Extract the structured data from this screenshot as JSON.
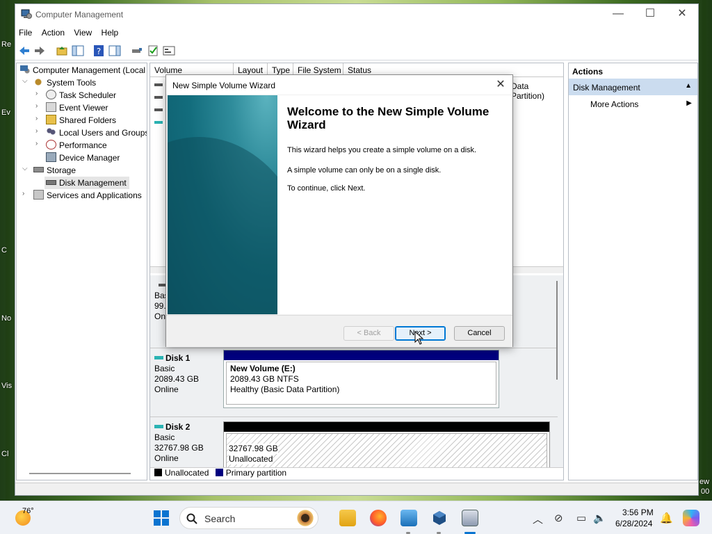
{
  "window": {
    "title": "Computer Management",
    "min": "—",
    "max": "☐",
    "close": "✕"
  },
  "menu": [
    "File",
    "Action",
    "View",
    "Help"
  ],
  "tree": {
    "root": "Computer Management (Local",
    "system_tools": "System Tools",
    "items": [
      "Task Scheduler",
      "Event Viewer",
      "Shared Folders",
      "Local Users and Groups",
      "Performance",
      "Device Manager"
    ],
    "storage": "Storage",
    "disk_management": "Disk Management",
    "services": "Services and Applications"
  },
  "columns": [
    "Volume",
    "Layout",
    "Type",
    "File System",
    "Status"
  ],
  "status_partial": "Data Partition)",
  "disks": {
    "disk0": {
      "l1": "Bas",
      "l2": "99.",
      "l3": "Onl"
    },
    "disk1": {
      "name": "Disk 1",
      "type": "Basic",
      "size": "2089.43 GB",
      "state": "Online",
      "vol_name": "New Volume  (E:)",
      "vol_size": "2089.43 GB NTFS",
      "vol_status": "Healthy (Basic Data Partition)"
    },
    "disk2": {
      "name": "Disk 2",
      "type": "Basic",
      "size": "32767.98 GB",
      "state": "Online",
      "vol_size": "32767.98 GB",
      "vol_status": "Unallocated"
    }
  },
  "legend": {
    "unallocated": "Unallocated",
    "primary": "Primary partition"
  },
  "actions": {
    "header": "Actions",
    "section": "Disk Management",
    "more": "More Actions"
  },
  "wizard": {
    "title": "New Simple Volume Wizard",
    "heading": "Welcome to the New Simple Volume Wizard",
    "p1": "This wizard helps you create a simple volume on a disk.",
    "p2": "A simple volume can only be on a single disk.",
    "p3": "To continue, click Next.",
    "back": "< Back",
    "next": "Next >",
    "cancel": "Cancel"
  },
  "taskbar": {
    "temp": "76°",
    "search": "Search",
    "time": "3:56 PM",
    "date": "6/28/2024"
  },
  "desktop_fragments": [
    "Re",
    "Ev",
    "C",
    "No",
    "Vis",
    "Cl",
    "ew",
    "00"
  ],
  "colors": {
    "primary_partition": "#00007f",
    "unallocated": "#000000",
    "accent": "#0078d4",
    "selection": "#cbdcef"
  }
}
